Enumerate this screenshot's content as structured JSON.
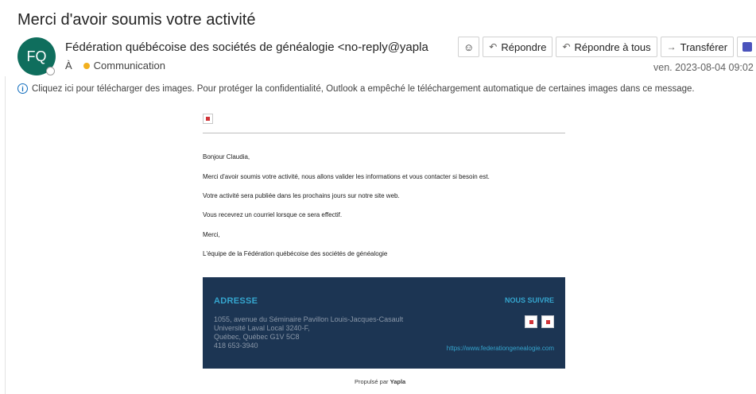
{
  "subject": "Merci d'avoir soumis votre activité",
  "sender": {
    "initials": "FQ",
    "display": "Fédération québécoise des sociétés de généalogie <no-reply@yapla",
    "to_label": "À",
    "recipient": "Communication"
  },
  "toolbar": {
    "emoji_icon": "smiley-icon",
    "reply": "Répondre",
    "reply_all": "Répondre à tous",
    "forward": "Transférer",
    "teams_icon": "teams-icon",
    "more": "···"
  },
  "date": "ven. 2023-08-04 09:02",
  "infobar": "Cliquez ici pour télécharger des images. Pour protéger la confidentialité, Outlook a empêché le téléchargement automatique de certaines images dans ce message.",
  "body": {
    "greeting": "Bonjour Claudia,",
    "p1": "Merci d'avoir soumis votre activité, nous allons valider les informations et vous contacter si besoin est.",
    "p2": "Votre activité sera publiée dans les prochains jours sur notre site web.",
    "p3": "Vous recevrez un courriel lorsque ce sera effectif.",
    "thanks": "Merci,",
    "signature": "L'équipe de la Fédération québécoise des sociétés de généalogie"
  },
  "footer": {
    "address_title": "ADRESSE",
    "follow_title": "NOUS SUIVRE",
    "address_lines": [
      "1055, avenue du Séminaire Pavillon Louis-Jacques-Casault",
      "Université Laval Local 3240-F,",
      "Québec, Québec  G1V 5C8",
      "418 653-3940"
    ],
    "website": "https://www.federationgenealogie.com"
  },
  "powered": {
    "prefix": "Propulsé par",
    "brand": "Yapla"
  },
  "colors": {
    "avatar": "#0f6e5d",
    "footer_bg": "#1c3553",
    "footer_accent": "#35a5ce",
    "info_blue": "#0f6cbd"
  }
}
